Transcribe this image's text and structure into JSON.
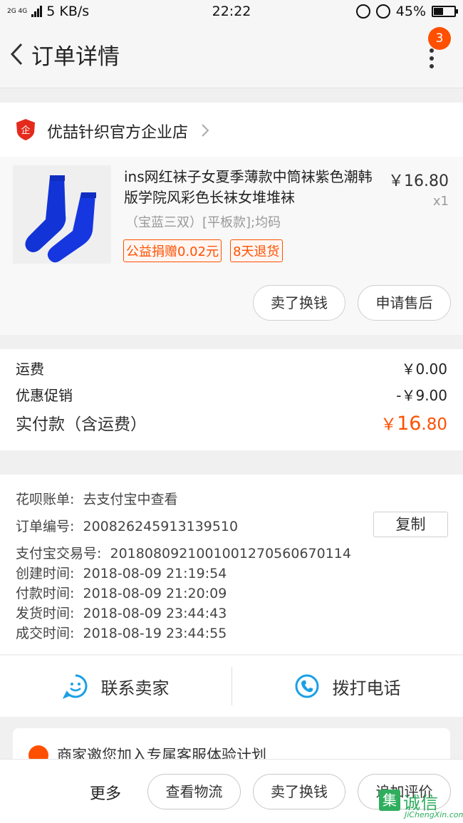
{
  "status_bar": {
    "network_labels": "2G 4G",
    "speed": "5 KB/s",
    "time": "22:22",
    "battery": "45%",
    "battery_level": 0.45
  },
  "nav": {
    "title": "订单详情",
    "badge_count": "3"
  },
  "shop": {
    "name": "优喆针织官方企业店",
    "icon_text": "企"
  },
  "item": {
    "title": "ins网红袜子女夏季薄款中筒袜紫色潮韩版学院风彩色长袜女堆堆袜",
    "price": "￥16.80",
    "quantity": "x1",
    "spec": "（宝蓝三双）[平板款];均码",
    "tags": [
      "公益捐赠0.02元",
      "8天退货"
    ],
    "actions": [
      "卖了换钱",
      "申请售后"
    ]
  },
  "costs": {
    "shipping_label": "运费",
    "shipping_value": "￥0.00",
    "discount_label": "优惠促销",
    "discount_value": "-￥9.00",
    "total_label": "实付款（含运费）",
    "total_currency": "￥",
    "total_int": "16",
    "total_dec": ".80"
  },
  "order_info": {
    "huabei_label": "花呗账单:",
    "huabei_value": "去支付宝中查看",
    "order_no_label": "订单编号:",
    "order_no_value": "200826245913139510",
    "copy_label": "复制",
    "alipay_label": "支付宝交易号:",
    "alipay_value": "20180809210010012705606701​14",
    "created_label": "创建时间:",
    "created_value": "2018-08-09 21:19:54",
    "paid_label": "付款时间:",
    "paid_value": "2018-08-09 21:20:09",
    "shipped_label": "发货时间:",
    "shipped_value": "2018-08-09 23:44:43",
    "completed_label": "成交时间:",
    "completed_value": "2018-08-19 23:44:55"
  },
  "contact": {
    "seller_label": "联系卖家",
    "phone_label": "拨打电话"
  },
  "promo": {
    "text": "商家邀您加入专属客服体验计划"
  },
  "bottom_bar": {
    "more_label": "更多",
    "buttons": [
      "查看物流",
      "卖了换钱",
      "追加评价"
    ]
  },
  "watermark": {
    "logo_char": "集",
    "cn_text": "诚信",
    "en_text": "JiChengXin.com"
  },
  "colors": {
    "accent": "#ff5000",
    "icon_blue": "#1aa0e6",
    "sock_blue": "#1233d6"
  }
}
